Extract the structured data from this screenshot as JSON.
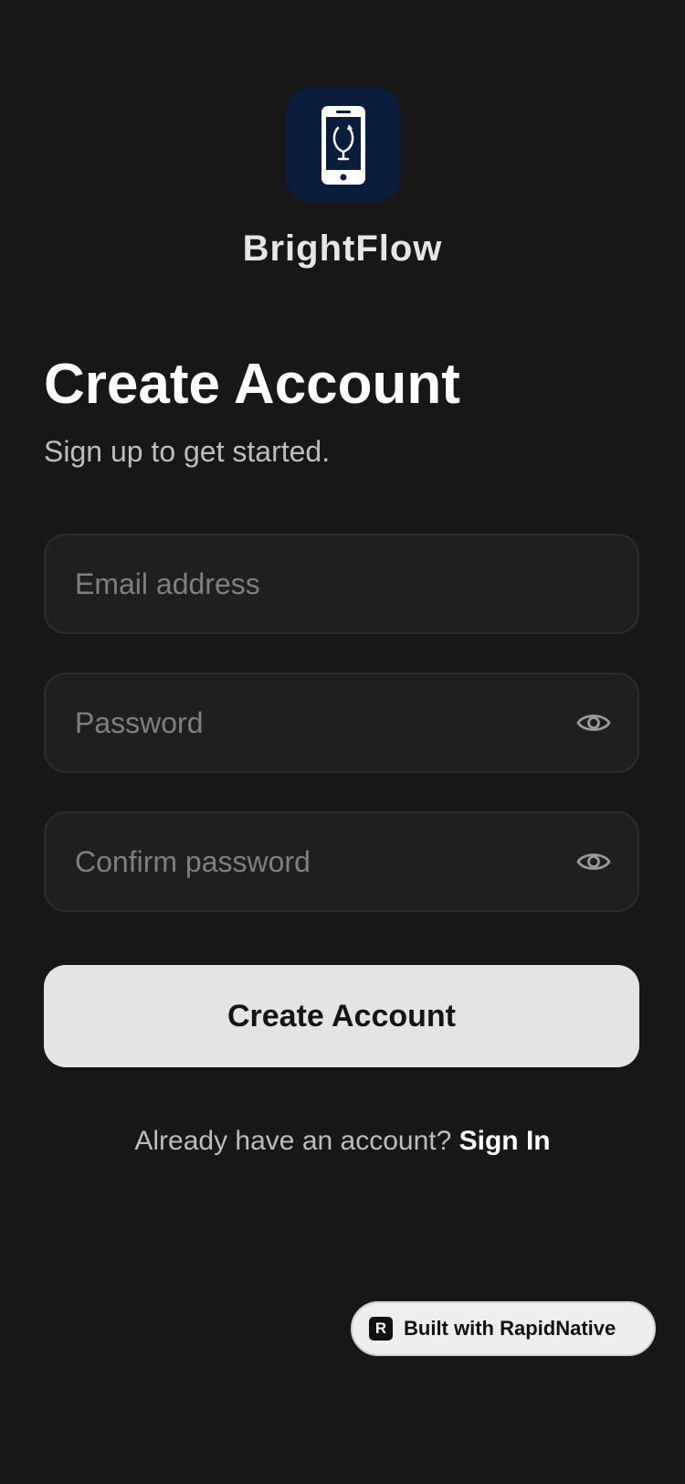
{
  "app": {
    "name": "BrightFlow",
    "logo_icon": "phone-icon",
    "logo_bg": "#0b1d3d"
  },
  "header": {
    "title": "Create Account",
    "subtitle": "Sign up to get started."
  },
  "form": {
    "email": {
      "value": "",
      "placeholder": "Email address"
    },
    "password": {
      "value": "",
      "placeholder": "Password",
      "toggle_icon": "eye-icon"
    },
    "confirm_password": {
      "value": "",
      "placeholder": "Confirm password",
      "toggle_icon": "eye-icon"
    },
    "submit_label": "Create Account"
  },
  "footer": {
    "prompt": "Already have an account?",
    "link": "Sign In"
  },
  "badge": {
    "icon_letter": "R",
    "label": "Built with RapidNative"
  },
  "colors": {
    "background": "#171717",
    "field_bg": "#1f1f1f",
    "button_bg": "#e4e4e6",
    "placeholder": "#7f7f7f"
  }
}
